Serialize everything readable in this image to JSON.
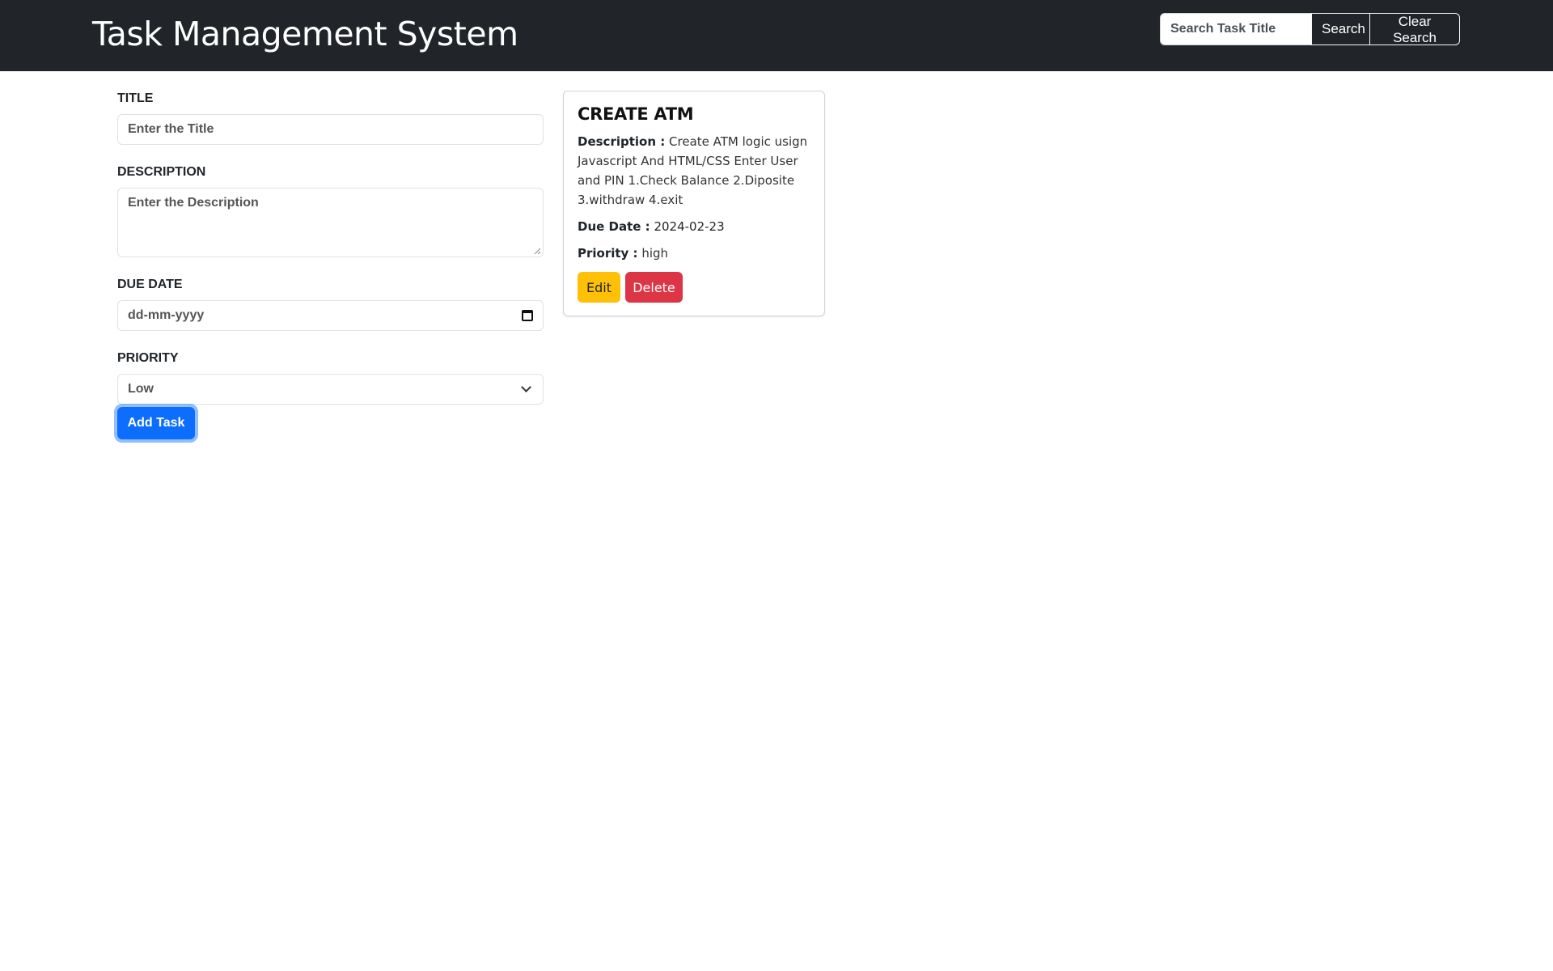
{
  "header": {
    "title": "Task Management System",
    "search_placeholder": "Search Task Title",
    "search_label": "Search",
    "clear_label": "Clear Search"
  },
  "form": {
    "title_label": "TITLE",
    "title_placeholder": "Enter the Title",
    "description_label": "DESCRIPTION",
    "description_placeholder": "Enter the Description",
    "due_date_label": "DUE DATE",
    "due_date_placeholder": "dd-mm-yyyy",
    "priority_label": "PRIORITY",
    "priority_selected": "Low",
    "submit_label": "Add Task"
  },
  "tasks": [
    {
      "title": "CREATE ATM",
      "description_label": "Description :",
      "description": "Create ATM logic usign Javascript And HTML/CSS Enter User and PIN 1.Check Balance 2.Diposite 3.withdraw 4.exit",
      "due_date_label": "Due Date :",
      "due_date": "2024-02-23",
      "priority_label": "Priority :",
      "priority": "high",
      "edit_label": "Edit",
      "delete_label": "Delete"
    }
  ],
  "colors": {
    "navbar": "#212529",
    "primary": "#0d6efd",
    "warning": "#ffc107",
    "danger": "#dc3545"
  }
}
